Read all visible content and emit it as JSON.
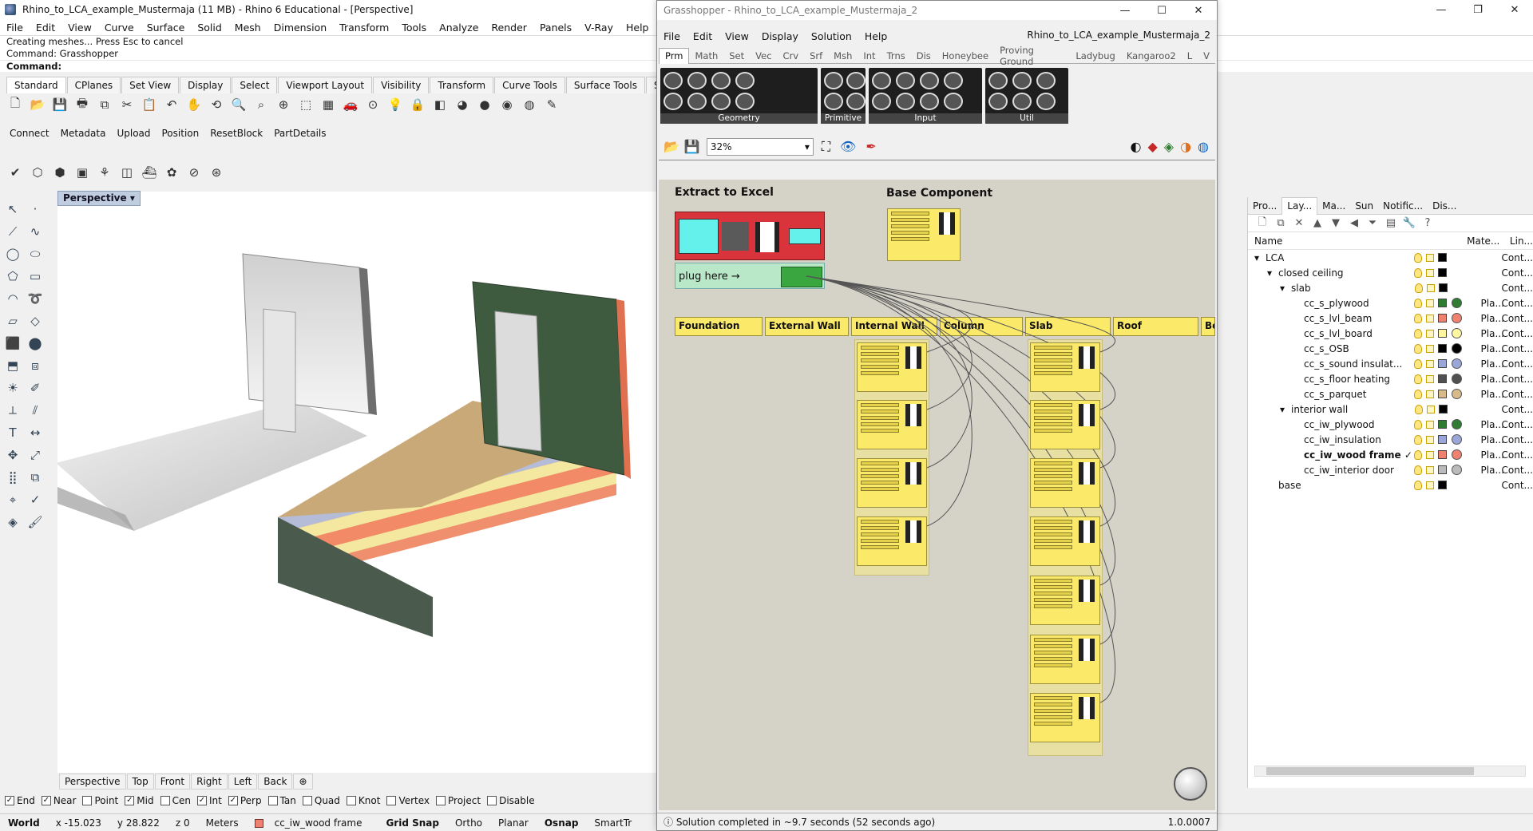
{
  "rhino": {
    "title": "Rhino_to_LCA_example_Mustermaja (11 MB) - Rhino 6 Educational - [Perspective]",
    "menu": [
      "File",
      "Edit",
      "View",
      "Curve",
      "Surface",
      "Solid",
      "Mesh",
      "Dimension",
      "Transform",
      "Tools",
      "Analyze",
      "Render",
      "Panels",
      "V-Ray",
      "Help"
    ],
    "command_history": [
      "Creating meshes... Press Esc to cancel",
      "Command: Grasshopper"
    ],
    "command_prompt": "Command:",
    "toolbar_tabs": [
      "Standard",
      "CPlanes",
      "Set View",
      "Display",
      "Select",
      "Viewport Layout",
      "Visibility",
      "Transform",
      "Curve Tools",
      "Surface Tools",
      "Solid Tools"
    ],
    "plugin_toolbar": [
      "Connect",
      "Metadata",
      "Upload",
      "Position",
      "ResetBlock",
      "PartDetails"
    ],
    "viewport_title": "Perspective",
    "viewport_tabs": [
      "Perspective",
      "Top",
      "Front",
      "Right",
      "Left",
      "Back"
    ],
    "osnaps": [
      {
        "label": "End",
        "checked": true
      },
      {
        "label": "Near",
        "checked": true
      },
      {
        "label": "Point",
        "checked": false
      },
      {
        "label": "Mid",
        "checked": true
      },
      {
        "label": "Cen",
        "checked": false
      },
      {
        "label": "Int",
        "checked": true
      },
      {
        "label": "Perp",
        "checked": true
      },
      {
        "label": "Tan",
        "checked": false
      },
      {
        "label": "Quad",
        "checked": false
      },
      {
        "label": "Knot",
        "checked": false
      },
      {
        "label": "Vertex",
        "checked": false
      },
      {
        "label": "Project",
        "checked": false
      },
      {
        "label": "Disable",
        "checked": false
      }
    ],
    "status": {
      "cplane": "World",
      "x": "x -15.023",
      "y": "y 28.822",
      "z": "z 0",
      "units": "Meters",
      "layer": "cc_iw_wood frame",
      "grid_snap": "Grid Snap",
      "ortho": "Ortho",
      "planar": "Planar",
      "osnap": "Osnap",
      "smarttrack": "SmartTr"
    }
  },
  "layers_panel": {
    "tabs": [
      "Pro...",
      "Lay...",
      "Ma...",
      "Sun",
      "Notific...",
      "Dis..."
    ],
    "col_name": "Name",
    "col_material": "Mate...",
    "col_linetype": "Lin...",
    "rows": [
      {
        "indent": 0,
        "toggle": "▾",
        "name": "LCA",
        "color": "#000000",
        "mat": "",
        "lt": "Cont...",
        "current": false
      },
      {
        "indent": 1,
        "toggle": "▾",
        "name": "closed ceiling",
        "color": "#000000",
        "mat": "",
        "lt": "Cont...",
        "current": false
      },
      {
        "indent": 2,
        "toggle": "▾",
        "name": "slab",
        "color": "#000000",
        "mat": "",
        "lt": "Cont...",
        "current": false
      },
      {
        "indent": 3,
        "toggle": "",
        "name": "cc_s_plywood",
        "color": "#2e7d32",
        "mat": "Pla...",
        "lt": "Cont...",
        "current": false
      },
      {
        "indent": 3,
        "toggle": "",
        "name": "cc_s_lvl_beam",
        "color": "#f08070",
        "mat": "Pla...",
        "lt": "Cont...",
        "current": false
      },
      {
        "indent": 3,
        "toggle": "",
        "name": "cc_s_lvl_board",
        "color": "#fff6a0",
        "mat": "Pla...",
        "lt": "Cont...",
        "current": false
      },
      {
        "indent": 3,
        "toggle": "",
        "name": "cc_s_OSB",
        "color": "#000000",
        "mat": "Pla...",
        "lt": "Cont...",
        "current": false
      },
      {
        "indent": 3,
        "toggle": "",
        "name": "cc_s_sound insulat...",
        "color": "#9aa6d8",
        "mat": "Pla...",
        "lt": "Cont...",
        "current": false
      },
      {
        "indent": 3,
        "toggle": "",
        "name": "cc_s_floor heating",
        "color": "#505050",
        "mat": "Pla...",
        "lt": "Cont...",
        "current": false
      },
      {
        "indent": 3,
        "toggle": "",
        "name": "cc_s_parquet",
        "color": "#d8b98a",
        "mat": "Pla...",
        "lt": "Cont...",
        "current": false
      },
      {
        "indent": 2,
        "toggle": "▾",
        "name": "interior wall",
        "color": "#000000",
        "mat": "",
        "lt": "Cont...",
        "current": false
      },
      {
        "indent": 3,
        "toggle": "",
        "name": "cc_iw_plywood",
        "color": "#2e7d32",
        "mat": "Pla...",
        "lt": "Cont...",
        "current": false
      },
      {
        "indent": 3,
        "toggle": "",
        "name": "cc_iw_insulation",
        "color": "#9aa6d8",
        "mat": "Pla...",
        "lt": "Cont...",
        "current": false
      },
      {
        "indent": 3,
        "toggle": "",
        "name": "cc_iw_wood frame ✓",
        "color": "#f08070",
        "mat": "Pla...",
        "lt": "Cont...",
        "current": true
      },
      {
        "indent": 3,
        "toggle": "",
        "name": "cc_iw_interior door",
        "color": "#bbbbbb",
        "mat": "Pla...",
        "lt": "Cont...",
        "current": false
      },
      {
        "indent": 1,
        "toggle": "",
        "name": "base",
        "color": "#000000",
        "mat": "",
        "lt": "Cont...",
        "current": false
      }
    ]
  },
  "grasshopper": {
    "title": "Grasshopper - Rhino_to_LCA_example_Mustermaja_2",
    "doc_title": "Rhino_to_LCA_example_Mustermaja_2",
    "menu": [
      "File",
      "Edit",
      "View",
      "Display",
      "Solution",
      "Help"
    ],
    "category_tabs": [
      "Prm",
      "Math",
      "Set",
      "Vec",
      "Crv",
      "Srf",
      "Msh",
      "Int",
      "Trns",
      "Dis",
      "Honeybee",
      "Proving Ground",
      "Ladybug",
      "Kangaroo2",
      "L",
      "V"
    ],
    "ribbon_groups": [
      "Geometry",
      "Primitive",
      "Input",
      "Util"
    ],
    "zoom": "32%",
    "group_extract": "Extract to Excel",
    "group_base": "Base Component",
    "plug_here": "plug here →",
    "headers": [
      "Foundation",
      "External Wall",
      "Internal Wall",
      "Column",
      "Slab",
      "Roof",
      "Bea"
    ],
    "status": "Solution completed in ~9.7 seconds (52 seconds ago)",
    "version": "1.0.0007"
  }
}
